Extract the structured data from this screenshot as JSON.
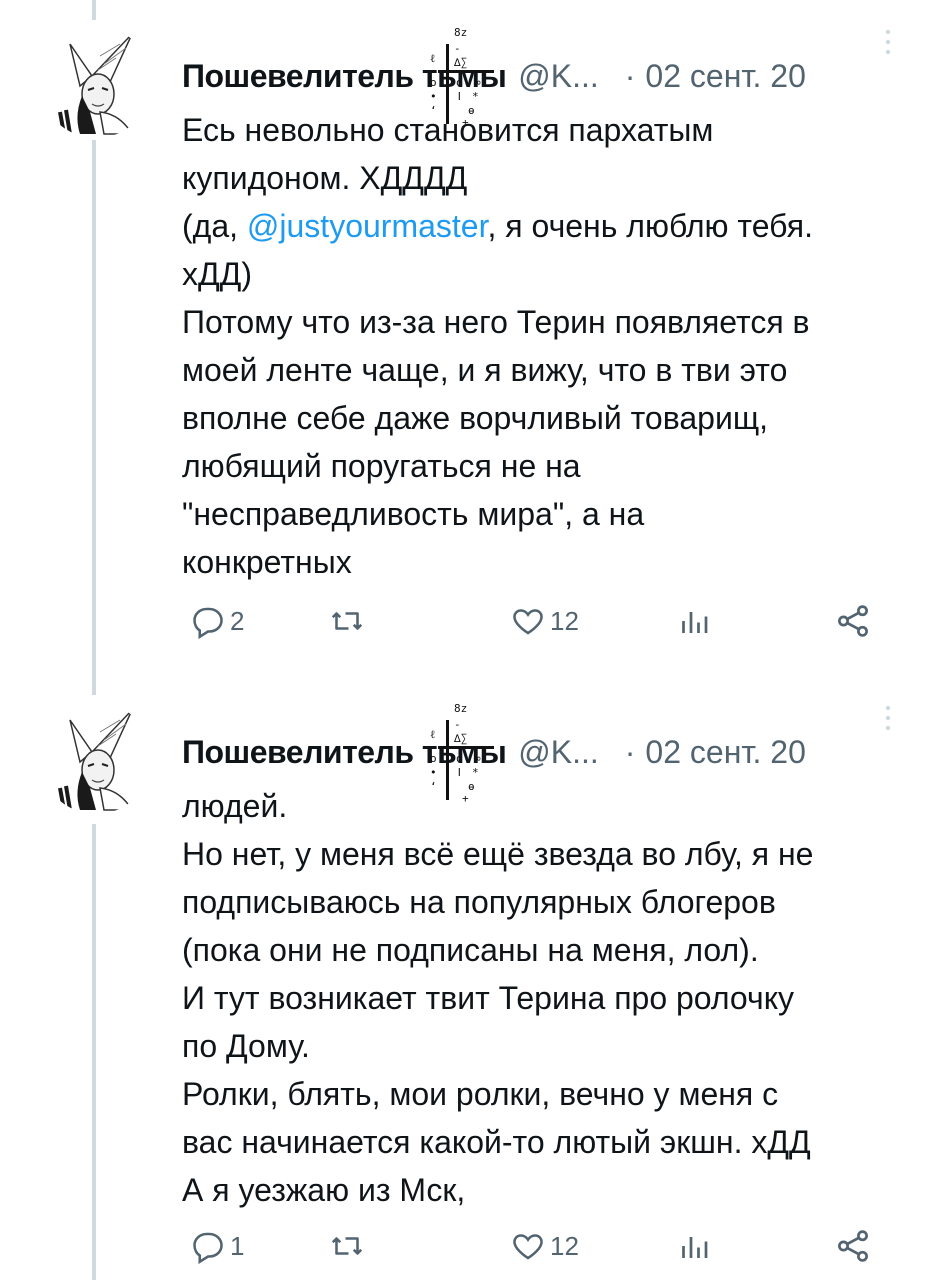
{
  "tweets": [
    {
      "display_name": "Пошевелитель тьмы",
      "handle": "@K...",
      "separator": "·",
      "date": "02 сент. 20",
      "text_before": "Есь невольно становится пархатым\nкупидоном. ХДДДД\n(да, ",
      "mention": "@justyourmaster",
      "text_after": ", я очень люблю тебя.\nхДД)\nПотому что из-за него Терин появляется в\nмоей ленте чаще, и я вижу, что в тви это\nвполне себе даже ворчливый товарищ,\nлюбящий поругаться не на\n\"несправедливость мира\", а на\nконкретных",
      "reply_count": "2",
      "retweet_count": "",
      "like_count": "12"
    },
    {
      "display_name": "Пошевелитель тьмы",
      "handle": "@K...",
      "separator": "·",
      "date": "02 сент. 20",
      "text": "людей.\nНо нет, у меня всё ещё звезда во лбу, я не\nподписываюсь на популярных блогеров\n(пока они не подписаны на меня, лол).\nИ тут возникает твит Терина про ролочку\nпо Дому.\nРолки, блять, мои ролки, вечно у меня с\nвас начинается какой-то лютый экшн. хДД\nА я уезжаю из Мск,",
      "reply_count": "1",
      "retweet_count": "",
      "like_count": "12"
    }
  ],
  "icons": {
    "reply": "reply-icon",
    "retweet": "retweet-icon",
    "like": "heart-icon",
    "views": "views-icon",
    "share": "share-icon",
    "more": "more-vertical-icon"
  },
  "colors": {
    "text": "#0f1419",
    "secondary": "#536471",
    "link": "#1d9bf0",
    "thread_line": "#cfd9de"
  }
}
